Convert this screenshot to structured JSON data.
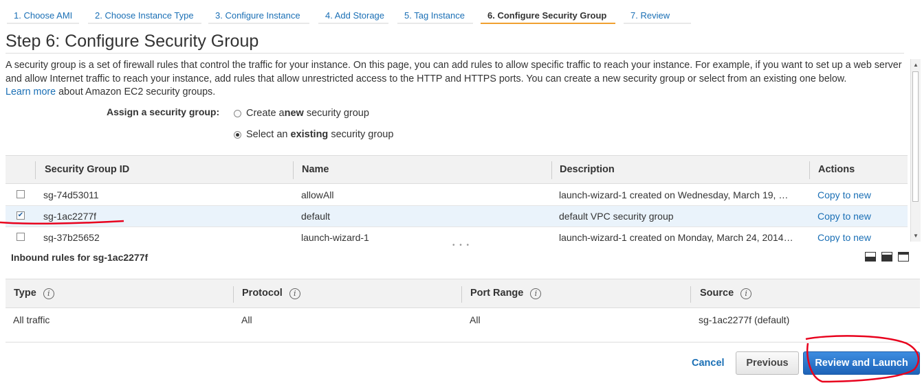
{
  "wizard_tabs": [
    {
      "label": "1. Choose AMI",
      "active": false
    },
    {
      "label": "2. Choose Instance Type",
      "active": false
    },
    {
      "label": "3. Configure Instance",
      "active": false
    },
    {
      "label": "4. Add Storage",
      "active": false
    },
    {
      "label": "5. Tag Instance",
      "active": false
    },
    {
      "label": "6. Configure Security Group",
      "active": true
    },
    {
      "label": "7. Review",
      "active": false
    }
  ],
  "page_title": "Step 6: Configure Security Group",
  "intro": {
    "text": "A security group is a set of firewall rules that control the traffic for your instance. On this page, you can add rules to allow specific traffic to reach your instance. For example, if you want to set up a web server and allow Internet traffic to reach your instance, add rules that allow unrestricted access to the HTTP and HTTPS ports. You can create a new security group or select from an existing one below.",
    "learn_more": "Learn more",
    "suffix": " about Amazon EC2 security groups."
  },
  "assign": {
    "label": "Assign a security group:",
    "option_new": {
      "prefix": "Create a ",
      "bold": "new",
      "suffix": " security group",
      "selected": false
    },
    "option_existing": {
      "prefix": "Select an ",
      "bold": "existing",
      "suffix": " security group",
      "selected": true
    }
  },
  "sg_table": {
    "columns": [
      "Security Group ID",
      "Name",
      "Description",
      "Actions"
    ],
    "rows": [
      {
        "id": "sg-74d53011",
        "name": "allowAll",
        "description": "launch-wizard-1 created on Wednesday, March 19, …",
        "action": "Copy to new",
        "checked": false
      },
      {
        "id": "sg-1ac2277f",
        "name": "default",
        "description": "default VPC security group",
        "action": "Copy to new",
        "checked": true
      },
      {
        "id": "sg-37b25652",
        "name": "launch-wizard-1",
        "description": "launch-wizard-1 created on Monday, March 24, 2014…",
        "action": "Copy to new",
        "checked": false
      }
    ]
  },
  "inbound": {
    "title": "Inbound rules for sg-1ac2277f",
    "columns": [
      "Type",
      "Protocol",
      "Port Range",
      "Source"
    ],
    "rows": [
      {
        "type": "All traffic",
        "protocol": "All",
        "port_range": "All",
        "source": "sg-1ac2277f (default)"
      }
    ]
  },
  "buttons": {
    "cancel": "Cancel",
    "previous": "Previous",
    "review_launch": "Review and Launch"
  },
  "colors": {
    "link": "#1a6fb5",
    "active_tab_underline": "#f0a030",
    "primary_button": "#1e63b8",
    "annotation": "#e8001c"
  }
}
